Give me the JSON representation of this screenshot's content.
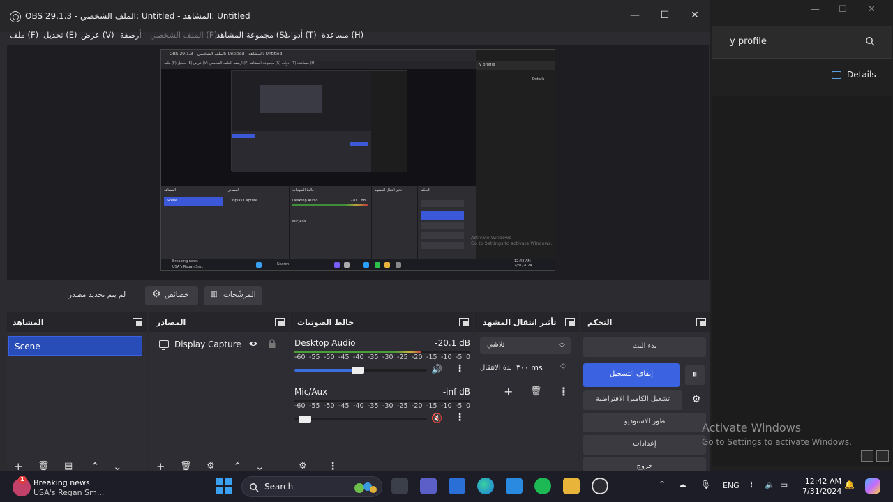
{
  "window": {
    "title": "OBS 29.1.3 - الملف الشخصي: Untitled - المشاهد: Untitled",
    "controls": {
      "minimize": "—",
      "maximize": "☐",
      "close": "✕"
    }
  },
  "menu": [
    {
      "label": "ملف (F)",
      "enabled": true
    },
    {
      "label": "تحديل (E)",
      "enabled": true
    },
    {
      "label": "عرض (V)",
      "enabled": true
    },
    {
      "label": "أرصفة",
      "enabled": true
    },
    {
      "label": "الملف الشخصي (P)",
      "enabled": false
    },
    {
      "label": "مجموعة المشاهد (S)",
      "enabled": true
    },
    {
      "label": "أدوات (T)",
      "enabled": true
    },
    {
      "label": "مساعدة (H)",
      "enabled": true
    }
  ],
  "preview": {
    "mini_title": "OBS 29.1.3 - الملف الشخصي: Untitled - المشاهد: Untitled",
    "mini_menu": "ملف (F)   تحديل (E)   عرض (V)   أرصفة   الملف الشخصي (P)   مجموعة المشاهد (S)   أدوات (T)   مساعدة (H)",
    "mini_search": "y profile",
    "mini_details": "Details",
    "mini_scene": "Scene",
    "mini_source": "Display Capture",
    "mini_audio": "Desktop Audio",
    "mini_audio_db": "-20.1 dB",
    "mini_mic": "Mic/Aux",
    "mini_activate_1": "Activate Windows",
    "mini_activate_2": "Go to Settings to activate Windows.",
    "mini_news_1": "Breaking news",
    "mini_news_2": "USA's Regan Sm...",
    "mini_search_bar": "Search",
    "mini_clock": "12:42 AM\n7/31/2024"
  },
  "source_toolbar": {
    "no_source": "لم يتم تحديد مصدر",
    "properties": "خصائص",
    "filters": "المرشّحات"
  },
  "docks": {
    "scenes": {
      "title": "المشاهد",
      "items": [
        "Scene"
      ]
    },
    "sources": {
      "title": "المصادر",
      "items": [
        {
          "name": "Display Capture",
          "visible": true,
          "locked": false
        }
      ]
    },
    "mixer": {
      "title": "خالط الصوتيات",
      "ticks": [
        "-60",
        "-55",
        "-50",
        "-45",
        "-40",
        "-35",
        "-30",
        "-25",
        "-20",
        "-15",
        "-10",
        "-5",
        "0"
      ],
      "channels": [
        {
          "name": "Desktop Audio",
          "db": "-20.1 dB",
          "level": 0.72,
          "volume": 0.48,
          "muted": false
        },
        {
          "name": "Mic/Aux",
          "db": "-inf dB",
          "level": 0.0,
          "volume": 0.08,
          "muted": true
        }
      ]
    },
    "transitions": {
      "title": "تأثير انتقال المشهد",
      "selected": "تلاشي",
      "duration_label": "مدة الانتقال",
      "duration_value": "٣٠٠ ms"
    },
    "controls": {
      "title": "التحكم",
      "start_stream": "بدء البث",
      "stop_record": "إيقاف التسجيل",
      "virtual_cam": "تشغيل الكاميرا الافتراضية",
      "studio_mode": "طور الاستوديو",
      "settings": "إعدادات",
      "exit": "خروج"
    }
  },
  "background_app": {
    "search_text": "y profile",
    "details": "Details"
  },
  "activation": {
    "line1": "Activate Windows",
    "line2": "Go to Settings to activate Windows."
  },
  "taskbar": {
    "news_title": "Breaking news",
    "news_sub": "USA's Regan Sm...",
    "news_badge": "1",
    "search": "Search",
    "lang": "ENG",
    "time": "12:42 AM",
    "date": "7/31/2024"
  },
  "colors": {
    "accent": "#3b62e0",
    "scene_selected": "#284cb8",
    "window_bg": "#2b2b30"
  }
}
